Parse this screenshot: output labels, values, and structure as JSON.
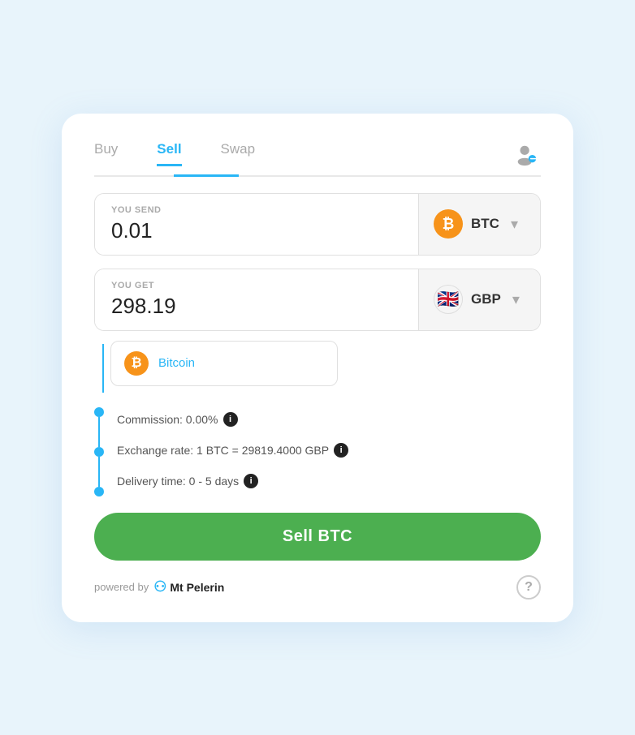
{
  "tabs": [
    {
      "label": "Buy",
      "active": false
    },
    {
      "label": "Sell",
      "active": true
    },
    {
      "label": "Swap",
      "active": false
    }
  ],
  "send": {
    "label": "YOU SEND",
    "value": "0.01",
    "currency": "BTC",
    "icon_type": "btc"
  },
  "get": {
    "label": "YOU GET",
    "value": "298.19",
    "currency": "GBP",
    "icon_type": "gbp"
  },
  "dropdown": {
    "label": "Bitcoin"
  },
  "info": {
    "commission": "Commission: 0.00%",
    "exchange_rate": "Exchange rate: 1 BTC = 29819.4000 GBP",
    "delivery_time": "Delivery time: 0 - 5 days"
  },
  "sell_button": "Sell BTC",
  "footer": {
    "powered_by": "powered by",
    "brand": "Mt Pelerin"
  },
  "icons": {
    "btc_symbol": "₿",
    "chevron": "▾",
    "info": "i",
    "question": "?",
    "profile": "👤"
  }
}
